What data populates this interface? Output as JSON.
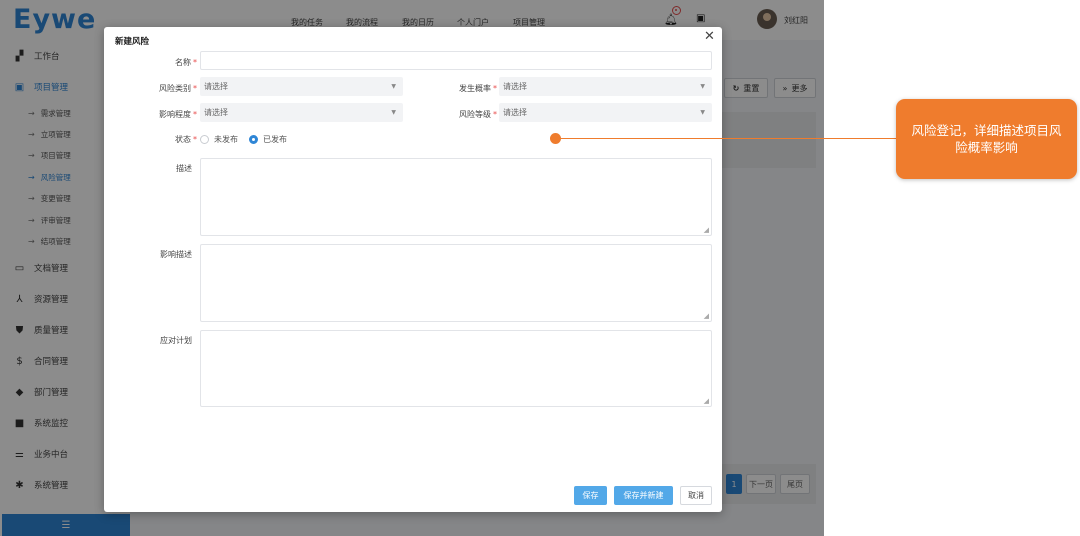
{
  "app": {
    "logo": "Eywe",
    "user_name": "刘红阳",
    "top_nav": [
      "我的任务",
      "我的流程",
      "我的日历",
      "个人门户",
      "项目管理"
    ]
  },
  "sidebar": {
    "items": [
      {
        "label": "工作台",
        "icon": "dashboard-icon"
      },
      {
        "label": "项目管理",
        "icon": "project-icon",
        "active": true
      },
      {
        "label": "文档管理",
        "icon": "document-icon"
      },
      {
        "label": "资源管理",
        "icon": "resource-icon"
      },
      {
        "label": "质量管理",
        "icon": "shield-icon"
      },
      {
        "label": "合同管理",
        "icon": "dollar-icon"
      },
      {
        "label": "部门管理",
        "icon": "department-icon"
      },
      {
        "label": "系统监控",
        "icon": "camera-icon"
      },
      {
        "label": "业务中台",
        "icon": "sliders-icon"
      },
      {
        "label": "系统管理",
        "icon": "gear-icon"
      }
    ],
    "sub_items": [
      "需求管理",
      "立项管理",
      "项目管理",
      "风险管理",
      "变更管理",
      "评审管理",
      "结项管理"
    ],
    "active_sub": "风险管理",
    "collapse_icon": "collapse-icon"
  },
  "background": {
    "reset_label": "重置",
    "more_label": "更多",
    "pager": {
      "current": "1",
      "next": "下一页",
      "last": "尾页"
    }
  },
  "modal": {
    "title": "新建风险",
    "fields": {
      "name_label": "名称",
      "name_value": "",
      "risk_type_label": "风险类别",
      "risk_type_placeholder": "请选择",
      "probability_label": "发生概率",
      "probability_placeholder": "请选择",
      "impact_label": "影响程度",
      "impact_placeholder": "请选择",
      "risk_level_label": "风险等级",
      "risk_level_placeholder": "请选择",
      "status_label": "状态",
      "status_options": [
        "未发布",
        "已发布"
      ],
      "status_selected": "已发布",
      "description_label": "描述",
      "impact_desc_label": "影响描述",
      "response_plan_label": "应对计划"
    },
    "buttons": {
      "save": "保存",
      "save_and_new": "保存并新建",
      "cancel": "取消"
    }
  },
  "annotation": {
    "callout_text": "风险登记，详细描述项目风险概率影响",
    "color": "#ef7c2d"
  },
  "colors": {
    "brand": "#2f86d6",
    "primary_button": "#52a8e8",
    "required": "#e84d4d"
  }
}
